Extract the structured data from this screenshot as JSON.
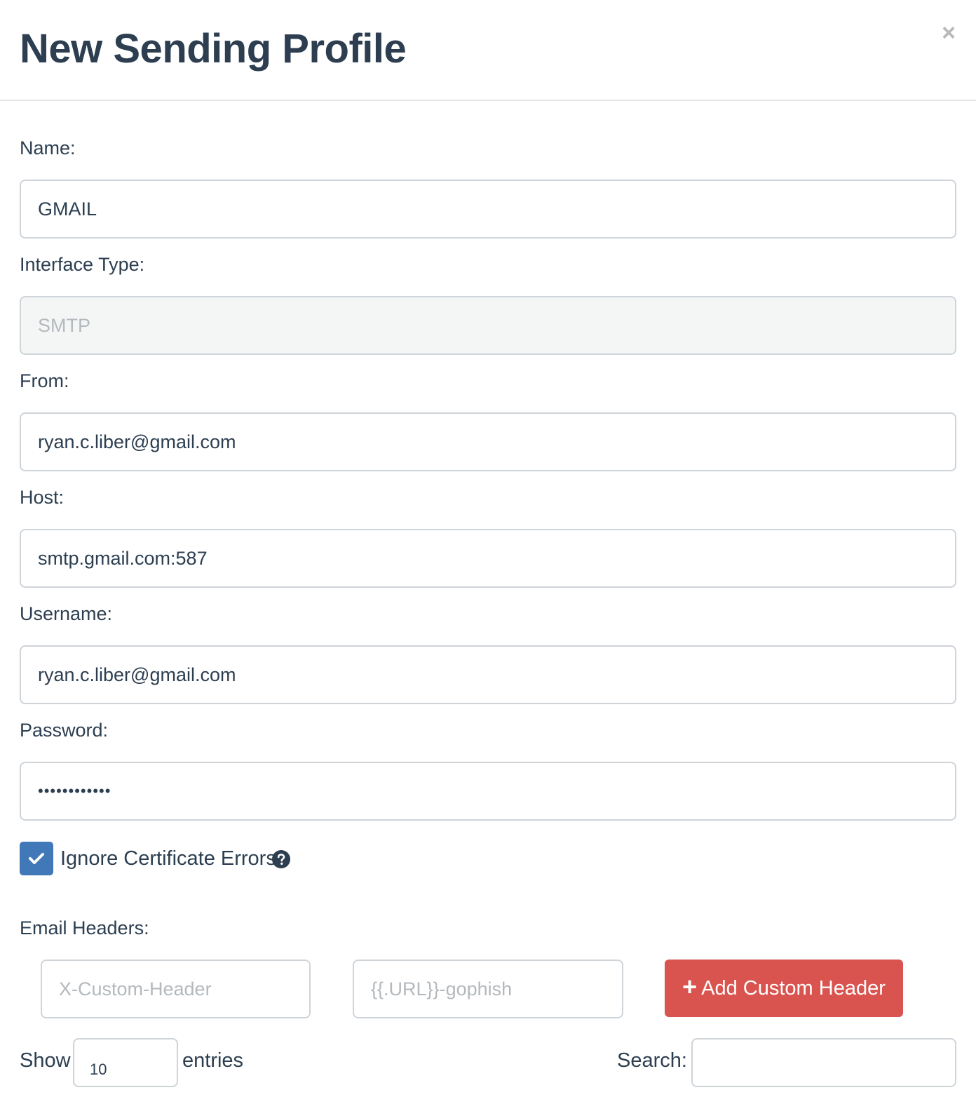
{
  "modal": {
    "title": "New Sending Profile",
    "close": "×"
  },
  "form": {
    "name": {
      "label": "Name:",
      "value": "GMAIL"
    },
    "interface_type": {
      "label": "Interface Type:",
      "value": "SMTP"
    },
    "from": {
      "label": "From:",
      "value": "ryan.c.liber@gmail.com"
    },
    "host": {
      "label": "Host:",
      "value": "smtp.gmail.com:587"
    },
    "username": {
      "label": "Username:",
      "value": "ryan.c.liber@gmail.com"
    },
    "password": {
      "label": "Password:",
      "value": "••••••••••••"
    },
    "ignore_cert": {
      "label": "Ignore Certificate Errors",
      "checked": true
    },
    "email_headers": {
      "label": "Email Headers:",
      "header_placeholder": "X-Custom-Header",
      "value_placeholder": "{{.URL}}-gophish",
      "add_button": "Add Custom Header"
    }
  },
  "table_controls": {
    "show": "Show",
    "length_value": "10",
    "entries": "entries",
    "search": "Search:"
  },
  "colors": {
    "accent": "#4178b8",
    "danger": "#d9534f",
    "title": "#2c3e50"
  }
}
